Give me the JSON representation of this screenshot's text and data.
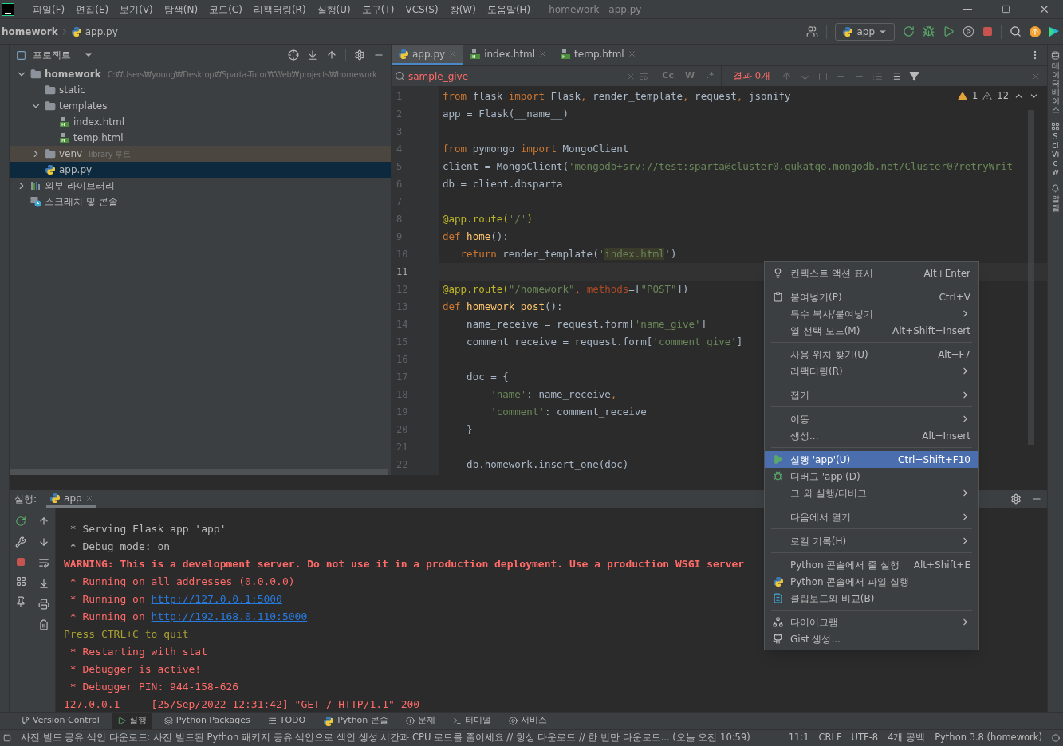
{
  "menu_bar": {
    "items": [
      "파일(F)",
      "편집(E)",
      "보기(V)",
      "탐색(N)",
      "코드(C)",
      "리팩터링(R)",
      "실행(U)",
      "도구(T)",
      "VCS(S)",
      "창(W)",
      "도움말(H)"
    ],
    "title": "homework - app.py"
  },
  "nav_bar": {
    "breadcrumbs": [
      "homework",
      "app.py"
    ],
    "run_config": "app"
  },
  "project_panel": {
    "title": "프로젝트",
    "tree": [
      {
        "label": "homework",
        "note": "C:₩Users₩young₩Desktop₩Sparta-Tutor₩Web₩projects₩homework",
        "kind": "folder",
        "bold": true,
        "expanded": true,
        "selected": false,
        "children": [
          {
            "label": "static",
            "kind": "folder",
            "selected": false
          },
          {
            "label": "templates",
            "kind": "folder",
            "expanded": true,
            "selected": false,
            "children": [
              {
                "label": "index.html",
                "kind": "html",
                "selected": false
              },
              {
                "label": "temp.html",
                "kind": "html",
                "selected": false
              }
            ]
          },
          {
            "label": "venv",
            "note": "library 루트",
            "kind": "library-folder",
            "expanded": false,
            "selected": false
          },
          {
            "label": "app.py",
            "kind": "python",
            "selected": true
          }
        ]
      },
      {
        "label": "외부 라이브러리",
        "kind": "libraries",
        "expanded": false,
        "selected": false
      },
      {
        "label": "스크래치 및 콘솔",
        "kind": "scratch",
        "selected": false
      }
    ]
  },
  "editor": {
    "tabs": [
      {
        "label": "app.py",
        "kind": "python",
        "selected": true
      },
      {
        "label": "index.html",
        "kind": "html",
        "selected": false
      },
      {
        "label": "temp.html",
        "kind": "html",
        "selected": false
      }
    ],
    "find": {
      "value": "sample_give",
      "options": [
        "Cc",
        "W",
        ".*"
      ],
      "result": "결과 0개"
    },
    "inspections": {
      "warnings": "1",
      "weak_warnings": "12"
    },
    "lines": [
      {
        "n": "1",
        "current": false,
        "tokens": [
          {
            "kind": "kw",
            "text": "from"
          },
          {
            "kind": "pl",
            "text": " flask "
          },
          {
            "kind": "kw",
            "text": "import"
          },
          {
            "kind": "pl",
            "text": " Flask"
          },
          {
            "kind": "kw",
            "text": ","
          },
          {
            "kind": "pl",
            "text": " render_template"
          },
          {
            "kind": "kw",
            "text": ","
          },
          {
            "kind": "pl",
            "text": " request"
          },
          {
            "kind": "kw",
            "text": ","
          },
          {
            "kind": "pl",
            "text": " jsonify"
          }
        ]
      },
      {
        "n": "2",
        "current": false,
        "tokens": [
          {
            "kind": "pl",
            "text": "app = Flask(__name__)"
          }
        ]
      },
      {
        "n": "3",
        "current": false
      },
      {
        "n": "4",
        "current": false,
        "tokens": [
          {
            "kind": "kw",
            "text": "from"
          },
          {
            "kind": "pl",
            "text": " pymongo "
          },
          {
            "kind": "kw",
            "text": "import"
          },
          {
            "kind": "pl",
            "text": " MongoClient"
          }
        ]
      },
      {
        "n": "5",
        "current": false,
        "tokens": [
          {
            "kind": "pl",
            "text": "client = MongoClient("
          },
          {
            "kind": "str",
            "text": "'mongodb+srv://test:sparta@cluster0.qukatqo.mongodb.net/Cluster0?retryWrit"
          }
        ]
      },
      {
        "n": "6",
        "current": false,
        "tokens": [
          {
            "kind": "pl",
            "text": "db = client.dbsparta"
          }
        ]
      },
      {
        "n": "7",
        "current": false
      },
      {
        "n": "8",
        "current": false,
        "tokens": [
          {
            "kind": "deco",
            "text": "@app.route("
          },
          {
            "kind": "str",
            "text": "'/'"
          },
          {
            "kind": "deco",
            "text": ")"
          }
        ]
      },
      {
        "n": "9",
        "current": false,
        "tokens": [
          {
            "kind": "kw",
            "text": "def"
          },
          {
            "kind": "fn",
            "text": " home"
          },
          {
            "kind": "pl",
            "text": "():"
          }
        ]
      },
      {
        "n": "10",
        "current": false,
        "tokens": [
          {
            "kind": "kw",
            "text": "   return"
          },
          {
            "kind": "pl",
            "text": " render_template("
          },
          {
            "kind": "str",
            "text": "'"
          },
          {
            "kind": "hl",
            "text": "index.html"
          },
          {
            "kind": "str",
            "text": "'"
          },
          {
            "kind": "pl",
            "text": ")"
          }
        ]
      },
      {
        "n": "11",
        "current": true
      },
      {
        "n": "12",
        "current": false,
        "tokens": [
          {
            "kind": "deco",
            "text": "@app.route("
          },
          {
            "kind": "str",
            "text": "\"/homework\""
          },
          {
            "kind": "kw",
            "text": ", "
          },
          {
            "kind": "param",
            "text": "methods"
          },
          {
            "kind": "pl",
            "text": "=["
          },
          {
            "kind": "str",
            "text": "\"POST\""
          },
          {
            "kind": "pl",
            "text": "])"
          }
        ]
      },
      {
        "n": "13",
        "current": false,
        "tokens": [
          {
            "kind": "kw",
            "text": "def"
          },
          {
            "kind": "fn",
            "text": " homework_post"
          },
          {
            "kind": "pl",
            "text": "():"
          }
        ]
      },
      {
        "n": "14",
        "current": false,
        "tokens": [
          {
            "kind": "pl",
            "text": "    name_receive = request.form["
          },
          {
            "kind": "str",
            "text": "'name_give'"
          },
          {
            "kind": "pl",
            "text": "]"
          }
        ]
      },
      {
        "n": "15",
        "current": false,
        "tokens": [
          {
            "kind": "pl",
            "text": "    comment_receive = request.form["
          },
          {
            "kind": "str",
            "text": "'comment_give'"
          },
          {
            "kind": "pl",
            "text": "]"
          }
        ]
      },
      {
        "n": "16",
        "current": false
      },
      {
        "n": "17",
        "current": false,
        "tokens": [
          {
            "kind": "pl",
            "text": "    doc = {"
          }
        ]
      },
      {
        "n": "18",
        "current": false,
        "tokens": [
          {
            "kind": "str",
            "text": "        'name'"
          },
          {
            "kind": "pl",
            "text": ": name_receive"
          },
          {
            "kind": "kw",
            "text": ","
          }
        ]
      },
      {
        "n": "19",
        "current": false,
        "tokens": [
          {
            "kind": "str",
            "text": "        'comment'"
          },
          {
            "kind": "pl",
            "text": ": comment_receive"
          }
        ]
      },
      {
        "n": "20",
        "current": false,
        "tokens": [
          {
            "kind": "pl",
            "text": "    }"
          }
        ]
      },
      {
        "n": "21",
        "current": false
      },
      {
        "n": "22",
        "current": false,
        "tokens": [
          {
            "kind": "pl",
            "text": "    db.homework.insert_one(doc)"
          }
        ]
      }
    ]
  },
  "context_menu": {
    "groups": [
      [
        {
          "label": "컨텍스트 액션 표시",
          "shortcut": "Alt+Enter",
          "selected": false
        }
      ],
      [
        {
          "label": "붙여넣기(P)",
          "shortcut": "Ctrl+V",
          "selected": false
        },
        {
          "label": "특수 복사/붙여넣기",
          "submenu": true,
          "selected": false
        },
        {
          "label": "열 선택 모드(M)",
          "shortcut": "Alt+Shift+Insert",
          "selected": false
        }
      ],
      [
        {
          "label": "사용 위치 찾기(U)",
          "shortcut": "Alt+F7",
          "selected": false
        },
        {
          "label": "리팩터링(R)",
          "submenu": true,
          "selected": false
        }
      ],
      [
        {
          "label": "접기",
          "submenu": true,
          "selected": false
        }
      ],
      [
        {
          "label": "이동",
          "submenu": true,
          "selected": false
        },
        {
          "label": "생성...",
          "shortcut": "Alt+Insert",
          "selected": false
        }
      ],
      [
        {
          "label": "실행 'app'(U)",
          "shortcut": "Ctrl+Shift+F10",
          "selected": true
        },
        {
          "label": "디버그 'app'(D)",
          "selected": false
        },
        {
          "label": "그 외 실행/디버그",
          "submenu": true,
          "selected": false
        }
      ],
      [
        {
          "label": "다음에서 열기",
          "submenu": true,
          "selected": false
        }
      ],
      [
        {
          "label": "로컬 기록(H)",
          "submenu": true,
          "selected": false
        }
      ],
      [
        {
          "label": "Python 콘솔에서 줄 실행",
          "shortcut": "Alt+Shift+E",
          "selected": false
        },
        {
          "label": "Python 콘솔에서 파일 실행",
          "selected": false
        },
        {
          "label": "클립보드와 비교(B)",
          "selected": false
        }
      ],
      [
        {
          "label": "다이어그램",
          "submenu": true,
          "selected": false
        },
        {
          "label": "Gist 생성...",
          "selected": false
        }
      ]
    ]
  },
  "run_panel": {
    "label": "실행:",
    "tab": "app",
    "console": [
      {
        "kind": "info",
        "tokens": [
          {
            "kind": "text",
            "text": " * Serving Flask app 'app'"
          }
        ]
      },
      {
        "kind": "info",
        "tokens": [
          {
            "kind": "text",
            "text": " * Debug mode: on"
          }
        ]
      },
      {
        "kind": "warning",
        "tokens": [
          {
            "kind": "text",
            "text": "WARNING: This is a development server. Do not use it in a production deployment. Use a production WSGI server"
          }
        ]
      },
      {
        "kind": "error",
        "tokens": [
          {
            "kind": "text",
            "text": " * Running on all addresses (0.0.0.0)"
          }
        ]
      },
      {
        "kind": "error",
        "tokens": [
          {
            "kind": "text",
            "text": " * Running on "
          },
          {
            "kind": "link",
            "text": "http://127.0.0.1:5000"
          }
        ]
      },
      {
        "kind": "error",
        "tokens": [
          {
            "kind": "text",
            "text": " * Running on "
          },
          {
            "kind": "link",
            "text": "http://192.168.0.110:5000"
          }
        ]
      },
      {
        "kind": "notice",
        "tokens": [
          {
            "kind": "text",
            "text": "Press CTRL+C to quit"
          }
        ]
      },
      {
        "kind": "error",
        "tokens": [
          {
            "kind": "text",
            "text": " * Restarting with stat"
          }
        ]
      },
      {
        "kind": "error",
        "tokens": [
          {
            "kind": "text",
            "text": " * Debugger is active!"
          }
        ]
      },
      {
        "kind": "error",
        "tokens": [
          {
            "kind": "text",
            "text": " * Debugger PIN: 944-158-626"
          }
        ]
      },
      {
        "kind": "error",
        "tokens": [
          {
            "kind": "text",
            "text": "127.0.0.1 - - [25/Sep/2022 12:31:42] \"GET / HTTP/1.1\" 200 -"
          }
        ]
      }
    ]
  },
  "tool_tabs": [
    {
      "label": "Version Control",
      "selected": false
    },
    {
      "label": "실행",
      "selected": true
    },
    {
      "label": "Python Packages",
      "selected": false
    },
    {
      "label": "TODO",
      "selected": false
    },
    {
      "label": "Python 콘솔",
      "selected": false
    },
    {
      "label": "문제",
      "selected": false
    },
    {
      "label": "터미널",
      "selected": false
    },
    {
      "label": "서비스",
      "selected": false
    }
  ],
  "right_strip": [
    "데이터베이스",
    "SciView",
    "알림"
  ],
  "status_bar": {
    "message": "사전 빌드 공유 색인 다운로드: 사전 빌드된 Python 패키지 공유 색인으로 색인 생성 시간과 CPU 로드를 줄이세요 // 항상 다운로드 // 한 번만 다운로드... (오늘 오전 10:59)",
    "items": [
      "11:1",
      "CRLF",
      "UTF-8",
      "4개 공백",
      "Python 3.8 (homework)"
    ]
  }
}
